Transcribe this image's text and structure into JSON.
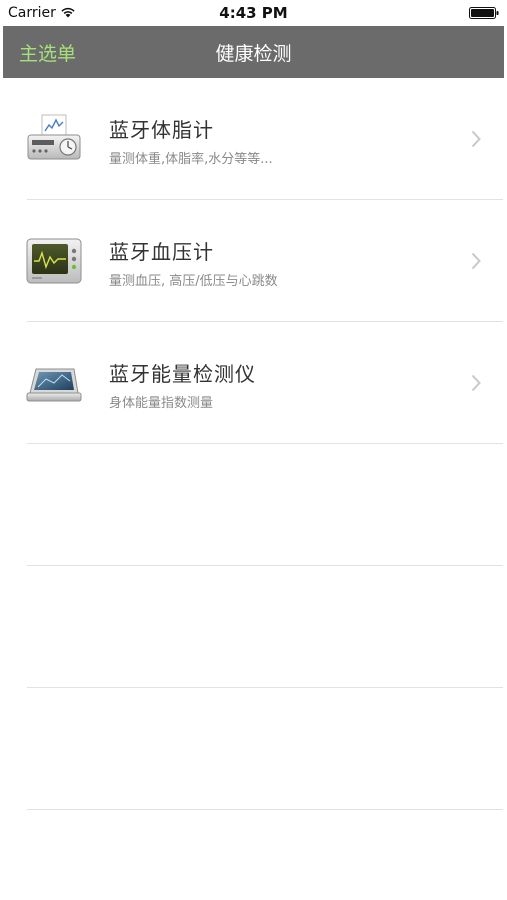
{
  "status_bar": {
    "carrier": "Carrier",
    "time": "4:43 PM"
  },
  "nav": {
    "back_label": "主选单",
    "title": "健康检测",
    "back_color": "#a6e07a",
    "bar_color": "#6b6b6b"
  },
  "items": [
    {
      "title": "蓝牙体脂计",
      "subtitle": "量测体重,体脂率,水分等等...",
      "icon": "body-fat-scale-icon"
    },
    {
      "title": "蓝牙血压计",
      "subtitle": "量测血压, 高压/低压与心跳数",
      "icon": "blood-pressure-monitor-icon"
    },
    {
      "title": "蓝牙能量检测仪",
      "subtitle": "身体能量指数测量",
      "icon": "energy-detector-icon"
    }
  ]
}
